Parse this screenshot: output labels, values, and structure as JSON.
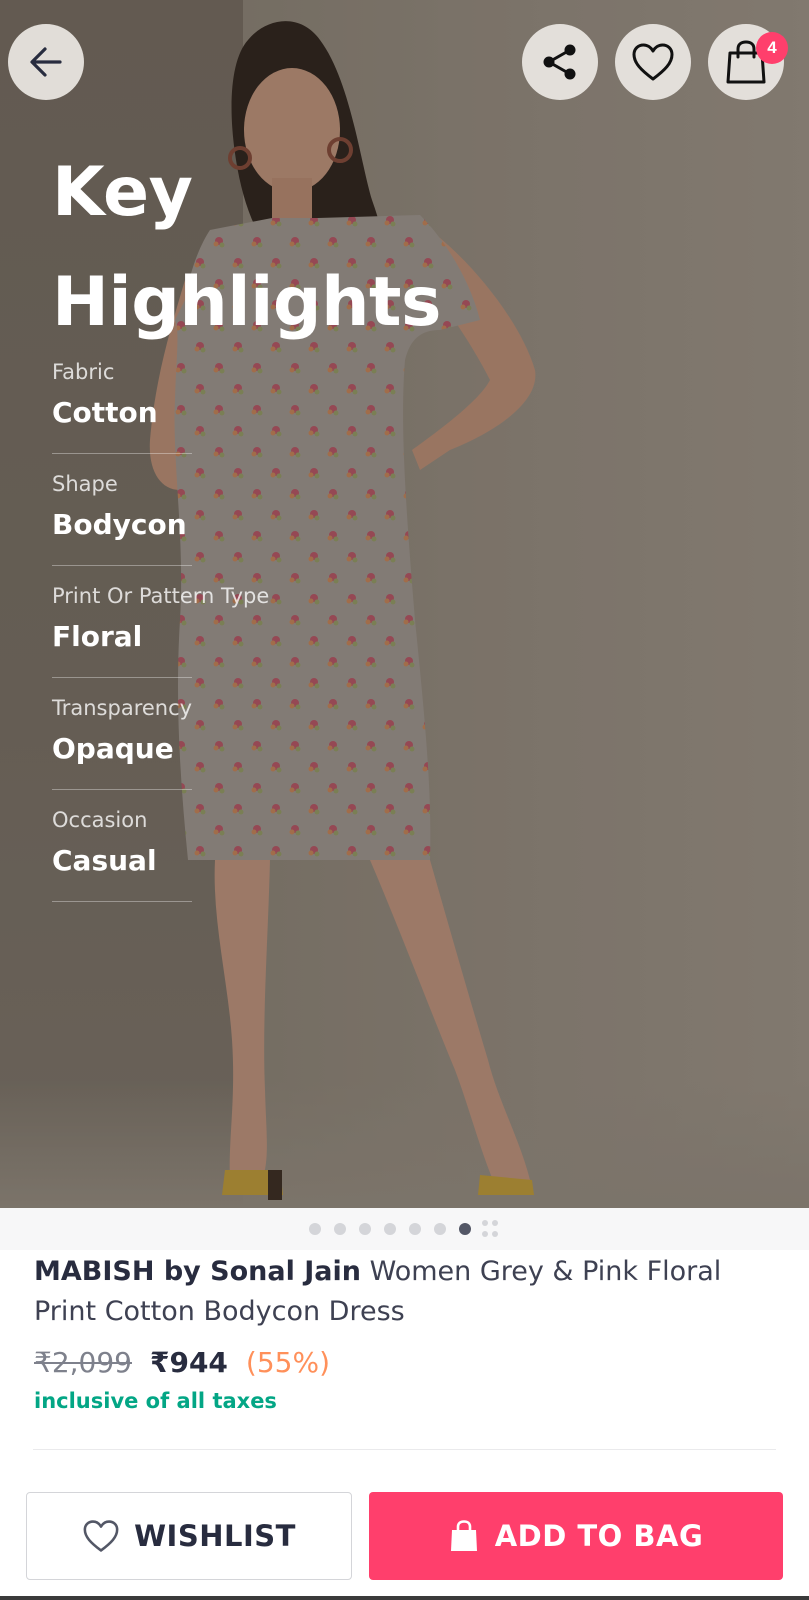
{
  "header": {
    "cart_count": "4"
  },
  "highlights": {
    "title": "Key Highlights",
    "items": [
      {
        "label": "Fabric",
        "value": "Cotton"
      },
      {
        "label": "Shape",
        "value": "Bodycon"
      },
      {
        "label": "Print Or Pattern Type",
        "value": "Floral"
      },
      {
        "label": "Transparency",
        "value": "Opaque"
      },
      {
        "label": "Occasion",
        "value": "Casual"
      }
    ]
  },
  "carousel": {
    "total_dots": 7,
    "active_index": 6
  },
  "product": {
    "brand": "MABISH by Sonal Jain",
    "name": "Women Grey & Pink Floral Print Cotton Bodycon Dress",
    "mrp": "₹2,099",
    "price": "₹944",
    "discount": "(55%)",
    "tax_note": "inclusive of all taxes"
  },
  "actions": {
    "wishlist_label": "WISHLIST",
    "add_to_bag_label": "ADD TO BAG"
  },
  "colors": {
    "accent": "#ff3f6c",
    "tax_green": "#03a685",
    "discount_orange": "#ff905a",
    "text_dark": "#282c3f"
  }
}
